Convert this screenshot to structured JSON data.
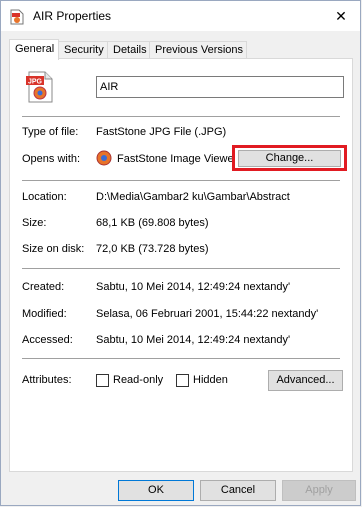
{
  "window": {
    "title": "AIR Properties",
    "close_glyph": "✕"
  },
  "tabs": [
    {
      "label": "General",
      "active": true
    },
    {
      "label": "Security"
    },
    {
      "label": "Details"
    },
    {
      "label": "Previous Versions"
    }
  ],
  "general": {
    "file_name": "AIR",
    "file_icon_badge": "JPG",
    "type_label": "Type of file:",
    "type_value": "FastStone JPG File (.JPG)",
    "opens_label": "Opens with:",
    "opens_value": "FastStone Image Viewe",
    "change_button": "Change...",
    "location_label": "Location:",
    "location_value": "D:\\Media\\Gambar2 ku\\Gambar\\Abstract",
    "size_label": "Size:",
    "size_value": "68,1 KB (69.808 bytes)",
    "size_disk_label": "Size on disk:",
    "size_disk_value": "72,0 KB (73.728 bytes)",
    "created_label": "Created:",
    "created_value": "Sabtu, 10 Mei 2014, 12:49:24 nextandy'",
    "modified_label": "Modified:",
    "modified_value": "Selasa, 06 Februari 2001, 15:44:22 nextandy'",
    "accessed_label": "Accessed:",
    "accessed_value": "Sabtu, 10 Mei 2014, 12:49:24 nextandy'",
    "attributes_label": "Attributes:",
    "readonly_label": "Read-only",
    "readonly_checked": false,
    "hidden_label": "Hidden",
    "hidden_checked": false,
    "advanced_button": "Advanced..."
  },
  "footer": {
    "ok": "OK",
    "cancel": "Cancel",
    "apply": "Apply"
  },
  "colors": {
    "highlight": "#e11b22",
    "accent": "#0078d7"
  }
}
